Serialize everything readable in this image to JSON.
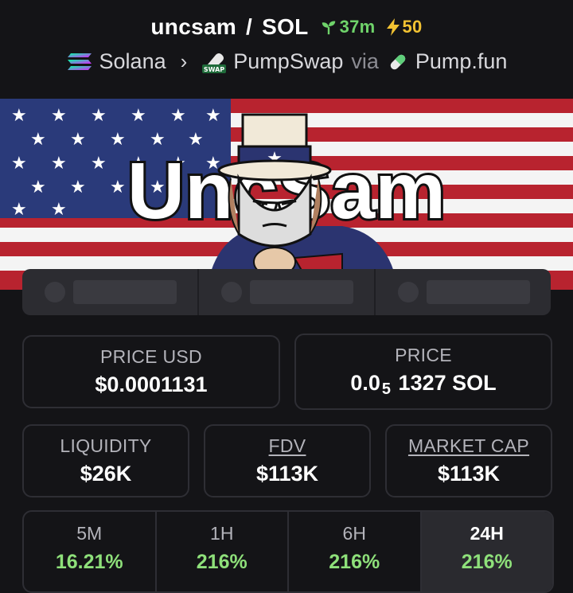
{
  "header": {
    "token_symbol": "uncsam",
    "separator": "/",
    "quote_symbol": "SOL",
    "age": "37m",
    "boost": "50"
  },
  "breadcrumb": {
    "chain": "Solana",
    "dex": "PumpSwap",
    "via": "via",
    "launchpad": "Pump.fun",
    "dex_badge_text": "SWAP"
  },
  "banner": {
    "title": "UncSam"
  },
  "stats": {
    "price_usd_label": "PRICE USD",
    "price_usd_value": "$0.0001131",
    "price_label": "PRICE",
    "price_value_prefix": "0.0",
    "price_value_zeros": "5",
    "price_value_suffix": "1327 SOL",
    "liquidity_label": "LIQUIDITY",
    "liquidity_value": "$26K",
    "fdv_label": "FDV",
    "fdv_value": "$113K",
    "mcap_label": "MARKET CAP",
    "mcap_value": "$113K"
  },
  "changes": [
    {
      "label": "5M",
      "value": "16.21%"
    },
    {
      "label": "1H",
      "value": "216%"
    },
    {
      "label": "6H",
      "value": "216%"
    },
    {
      "label": "24H",
      "value": "216%"
    }
  ],
  "colors": {
    "positive": "#8ee07a",
    "age": "#6fd36a",
    "boost": "#f2c232",
    "background": "#141417"
  }
}
